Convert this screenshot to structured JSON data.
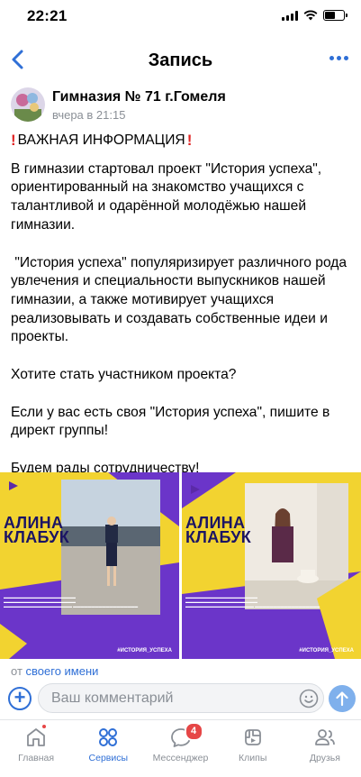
{
  "status_bar": {
    "time": "22:21"
  },
  "nav": {
    "title": "Запись"
  },
  "post": {
    "author": "Гимназия № 71 г.Гомеля",
    "time": "вчера в 21:15",
    "heading": "ВАЖНАЯ ИНФОРМАЦИЯ",
    "paragraphs": [
      "В гимназии стартовал проект \"История успеха\", ориентированный на знакомство учащихся с талантливой и одарённой молодёжью нашей гимназии.",
      " \"История успеха\" популяризирует различного рода увлечения и специальности выпускников нашей гимназии, а также мотивирует учащихся реализовывать и создавать собственные идеи и проекты.",
      "Хотите стать участником проекта?",
      "Если у вас есть своя \"История успеха\", пишите в директ группы!",
      "Будем рады сотрудничеству!"
    ],
    "photos": [
      {
        "name_line1": "АЛИНА",
        "name_line2": "КЛАБУК",
        "hashtag": "#ИСТОРИЯ_УСПЕХА"
      },
      {
        "name_line1": "АЛИНА",
        "name_line2": "КЛАБУК",
        "hashtag": "#ИСТОРИЯ_УСПЕХА"
      }
    ],
    "from_prefix": "от",
    "from_link": "своего имени"
  },
  "comment": {
    "placeholder": "Ваш комментарий"
  },
  "tabbar": {
    "items": [
      {
        "label": "Главная",
        "icon": "home-icon"
      },
      {
        "label": "Сервисы",
        "icon": "services-icon"
      },
      {
        "label": "Мессенджер",
        "icon": "messenger-icon",
        "badge": "4"
      },
      {
        "label": "Клипы",
        "icon": "clips-icon"
      },
      {
        "label": "Друзья",
        "icon": "friends-icon"
      }
    ]
  },
  "colors": {
    "accent": "#2f6fd6",
    "badge": "#e64646",
    "poster_yellow": "#f2d330",
    "poster_purple": "#6b35c9"
  }
}
